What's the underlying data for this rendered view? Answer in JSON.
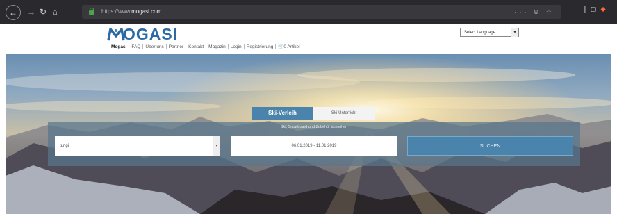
{
  "browser": {
    "url_prefix": "https://www.",
    "url_domain": "mogasi.com",
    "url_actions": "··· ⊕ ☆",
    "right_icons": "⫼ ▢"
  },
  "header": {
    "logo_text": "OGASI",
    "logo_initial": "M",
    "nav": [
      "Mogasi",
      "FAQ",
      "Über uns",
      "Partner",
      "Kontakt",
      "Magazin",
      "Login",
      "Registrierung",
      "0 Artikel"
    ],
    "cart_icon": "cart-icon",
    "language_select": "Select Language",
    "language_arrow": "▾"
  },
  "hero": {
    "tabs": [
      "Ski-Verleih",
      "Ski-Unterricht"
    ],
    "hint": "Ski, Snowboard und Zubehör ausleihen",
    "location_value": "turigi",
    "date_range": "06.01.2019 - 11.01.2019",
    "search_label": "SUCHEN"
  },
  "colors": {
    "brand": "#2c6aa3",
    "accent": "#4a84ad",
    "chrome": "#2a2a2e"
  }
}
